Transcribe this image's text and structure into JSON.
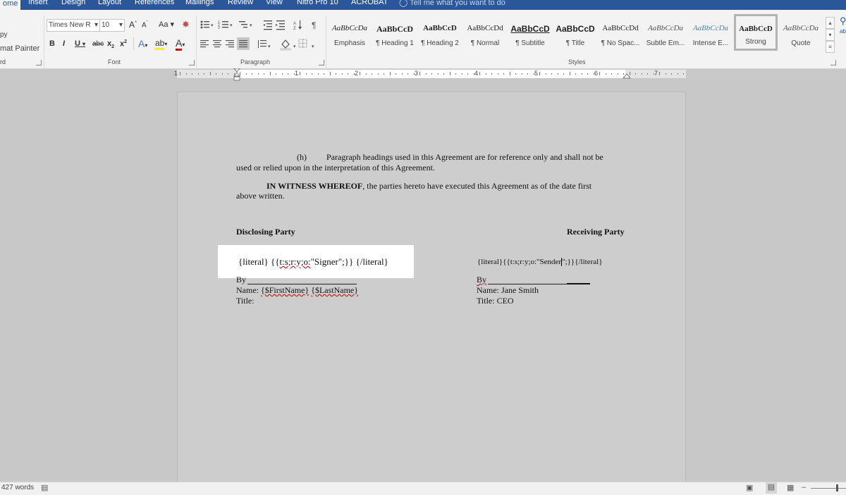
{
  "tabs": [
    "ome",
    "Insert",
    "Design",
    "Layout",
    "References",
    "Mailings",
    "Review",
    "View",
    "Nitro Pro 10",
    "ACROBAT"
  ],
  "tell_me": "Tell me what you want to do",
  "clipboard": {
    "copy": "py",
    "format_painter": "mat Painter",
    "group": "rd"
  },
  "font": {
    "name": "Times New R",
    "size": "10",
    "grow": "A",
    "shrink": "A",
    "case": "Aa",
    "bold": "B",
    "italic": "I",
    "underline": "U",
    "strike": "abc",
    "subscript": "x",
    "superscript": "x",
    "group": "Font"
  },
  "paragraph": {
    "group": "Paragraph"
  },
  "styles": {
    "group": "Styles",
    "items": [
      {
        "preview": "AaBbCcDa",
        "name": "Emphasis"
      },
      {
        "preview": "AaBbCcD",
        "name": "¶ Heading 1"
      },
      {
        "preview": "AaBbCcD",
        "name": "¶ Heading 2"
      },
      {
        "preview": "AaBbCcDd",
        "name": "¶ Normal"
      },
      {
        "preview": "AaBbCcD",
        "name": "¶ Subtitle"
      },
      {
        "preview": "AaBbCcD",
        "name": "¶ Title"
      },
      {
        "preview": "AaBbCcDd",
        "name": "¶ No Spac..."
      },
      {
        "preview": "AaBbCcDa",
        "name": "Subtle Em..."
      },
      {
        "preview": "AaBbCcDa",
        "name": "Intense E..."
      },
      {
        "preview": "AaBbCcD",
        "name": "Strong"
      },
      {
        "preview": "AaBbCcDa",
        "name": "Quote"
      }
    ],
    "selected_index": 9
  },
  "ruler_numbers": [
    "1",
    "1",
    "2",
    "3",
    "4",
    "5",
    "6",
    "7"
  ],
  "document": {
    "para_h_marker": "(h)",
    "para_h_line1": "Paragraph headings used in this Agreement are for reference only and shall not be",
    "para_h_line2": "used or relied upon in the interpretation of this Agreement.",
    "witness_bold": "IN WITNESS WHEREOF",
    "witness_rest": ", the parties hereto have executed this Agreement as of the date first",
    "witness_line2": "above written.",
    "disclosing_party": "Disclosing Party",
    "receiving_party": "Receiving Party",
    "left_tag_open": "{literal}",
    "left_tag_mid": "{{",
    "left_tag_field": "t:s;r:y;o:",
    "left_tag_value": "\"Signer\";}}",
    "left_tag_close": "{/literal}",
    "right_tag_open": "{literal}",
    "right_tag_mid": "{{t:s;r:y;o:\"Sender",
    "right_tag_value": "\";}}",
    "right_tag_close": "{/literal}",
    "left_by": "By",
    "left_name_label": "Name:",
    "left_first": "{$FirstName}",
    "left_last": "{$LastName}",
    "left_title": "Title:",
    "right_by": "By",
    "right_name": "Name: Jane Smith",
    "right_title": "Title: CEO"
  },
  "status": {
    "words": "427 words"
  }
}
